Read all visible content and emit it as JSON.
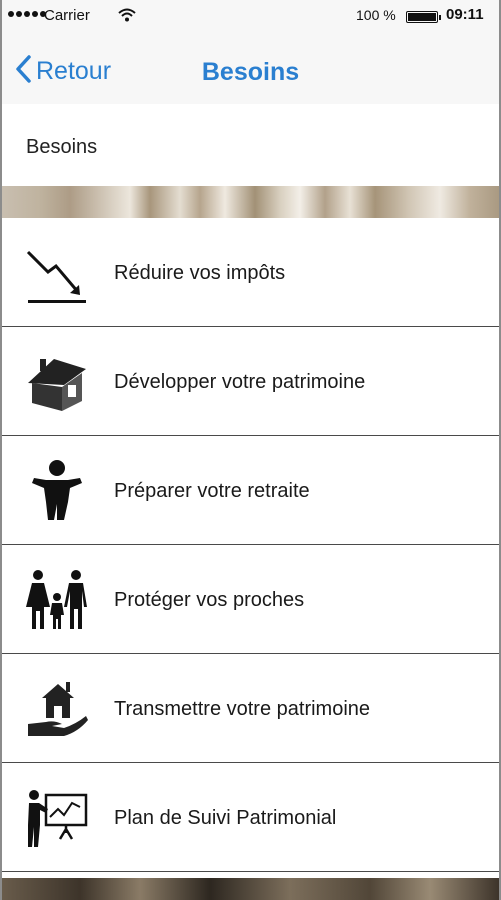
{
  "status_bar": {
    "carrier": "Carrier",
    "battery_percent": "100 %",
    "time": "09:11"
  },
  "nav": {
    "back_label": "Retour",
    "title": "Besoins"
  },
  "header": {
    "title": "Besoins"
  },
  "items": [
    {
      "label": "Réduire vos impôts",
      "icon": "trend-down-icon"
    },
    {
      "label": "Développer votre patrimoine",
      "icon": "house-icon"
    },
    {
      "label": "Préparer votre retraite",
      "icon": "person-icon"
    },
    {
      "label": "Protéger vos proches",
      "icon": "family-icon"
    },
    {
      "label": "Transmettre votre patrimoine",
      "icon": "house-hand-icon"
    },
    {
      "label": "Plan de Suivi Patrimonial",
      "icon": "presentation-icon"
    }
  ],
  "colors": {
    "accent": "#2a7fd0",
    "bar_background": "#f7f7f7",
    "divider": "#4a4a4a"
  }
}
